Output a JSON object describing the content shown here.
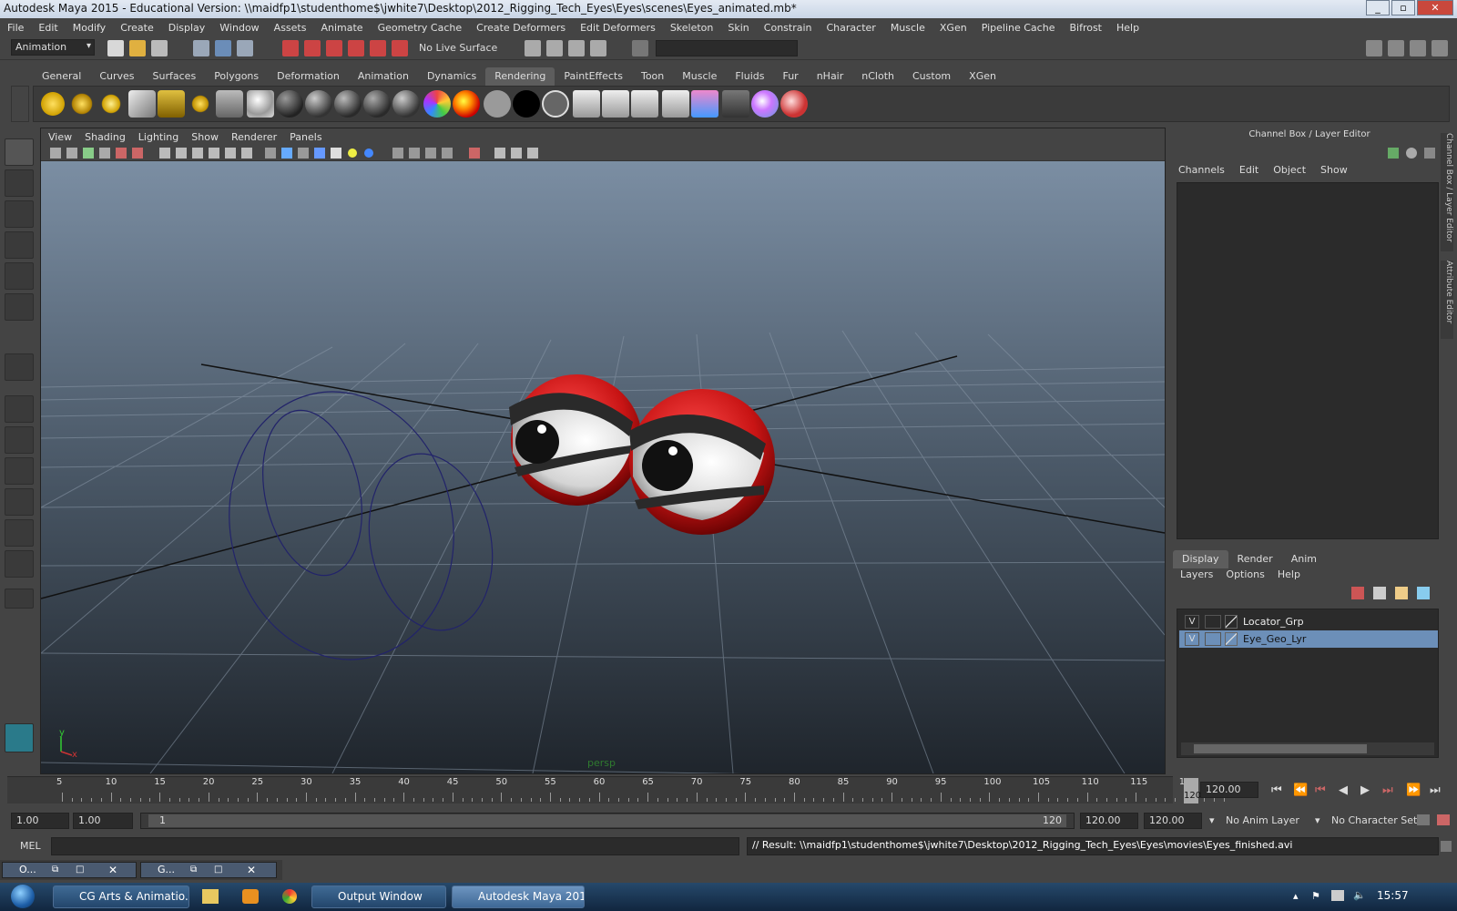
{
  "window": {
    "title": "Autodesk Maya 2015 - Educational Version: \\\\maidfp1\\studenthome$\\jwhite7\\Desktop\\2012_Rigging_Tech_Eyes\\Eyes\\scenes\\Eyes_animated.mb*",
    "min": "_",
    "max": "▫",
    "close": "✕"
  },
  "menubar": [
    "File",
    "Edit",
    "Modify",
    "Create",
    "Display",
    "Window",
    "Assets",
    "Animate",
    "Geometry Cache",
    "Create Deformers",
    "Edit Deformers",
    "Skeleton",
    "Skin",
    "Constrain",
    "Character",
    "Muscle",
    "XGen",
    "Pipeline Cache",
    "Bifrost",
    "Help"
  ],
  "statusline": {
    "mode": "Animation",
    "live_surface": "No Live Surface"
  },
  "shelf_tabs": [
    "General",
    "Curves",
    "Surfaces",
    "Polygons",
    "Deformation",
    "Animation",
    "Dynamics",
    "Rendering",
    "PaintEffects",
    "Toon",
    "Muscle",
    "Fluids",
    "Fur",
    "nHair",
    "nCloth",
    "Custom",
    "XGen"
  ],
  "shelf_active": "Rendering",
  "viewport": {
    "menus": [
      "View",
      "Shading",
      "Lighting",
      "Show",
      "Renderer",
      "Panels"
    ],
    "camera": "persp",
    "axis_y": "y",
    "axis_x": "x"
  },
  "channel_box": {
    "title": "Channel Box / Layer Editor",
    "menus": [
      "Channels",
      "Edit",
      "Object",
      "Show"
    ]
  },
  "side_tabs": [
    "Channel Box / Layer Editor",
    "Attribute Editor"
  ],
  "layer_editor": {
    "tabs": [
      "Display",
      "Render",
      "Anim"
    ],
    "active_tab": "Display",
    "menus": [
      "Layers",
      "Options",
      "Help"
    ],
    "layers": [
      {
        "v": "V",
        "name": "Locator_Grp",
        "selected": false
      },
      {
        "v": "V",
        "name": "Eye_Geo_Lyr",
        "selected": true
      }
    ]
  },
  "timeline": {
    "labels": [
      "5",
      "10",
      "15",
      "20",
      "25",
      "30",
      "35",
      "40",
      "45",
      "50",
      "55",
      "60",
      "65",
      "70",
      "75",
      "80",
      "85",
      "90",
      "95",
      "100",
      "105",
      "110",
      "115",
      "120"
    ],
    "current_frame": "120",
    "current_field": "120.00"
  },
  "range": {
    "start": "1.00",
    "anim_start": "1.00",
    "slider_start": "1",
    "slider_end": "120",
    "anim_end": "120.00",
    "end": "120.00",
    "anim_layer": "No Anim Layer",
    "char_set": "No Character Set"
  },
  "mel": {
    "label": "MEL",
    "result": "// Result: \\\\maidfp1\\studenthome$\\jwhite7\\Desktop\\2012_Rigging_Tech_Eyes\\Eyes\\movies\\Eyes_finished.avi"
  },
  "mini_windows": [
    "O...",
    "G..."
  ],
  "taskbar": {
    "tasks": [
      "CG Arts & Animatio...",
      "Output Window",
      "Autodesk Maya 2015..."
    ],
    "clock": "15:57"
  },
  "colors": {
    "eye_red": "#c81414",
    "selection": "#6c8fb8",
    "taskbar": "#1b3a5c"
  }
}
